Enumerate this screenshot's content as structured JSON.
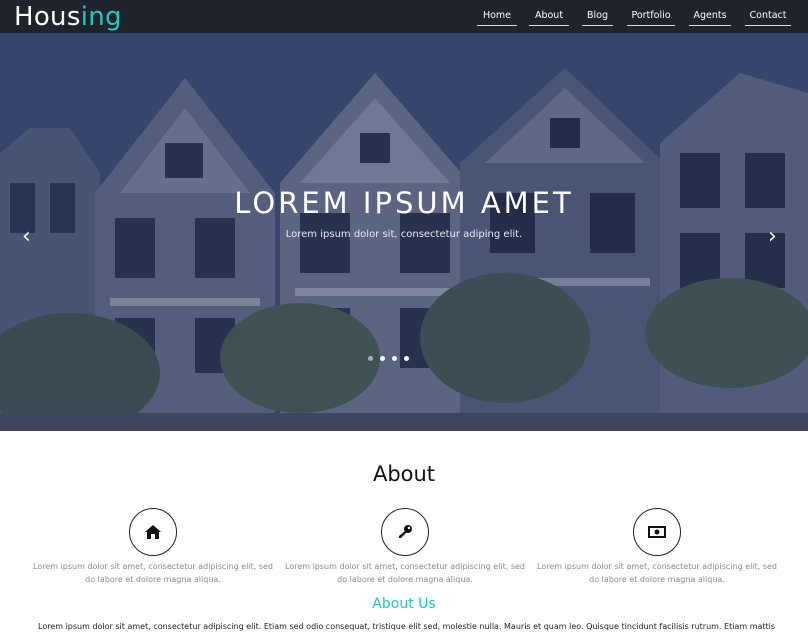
{
  "brand": {
    "part1": "Hous",
    "part2": "ing",
    "accent_color": "#23c6c0"
  },
  "nav": {
    "items": [
      {
        "label": "Home"
      },
      {
        "label": "About"
      },
      {
        "label": "Blog"
      },
      {
        "label": "Portfolio"
      },
      {
        "label": "Agents"
      },
      {
        "label": "Contact"
      }
    ],
    "background": "#1e232c"
  },
  "hero": {
    "title": "LOREM IPSUM AMET",
    "subtitle": "Lorem ipsum dolor sit, consectetur adiping elit.",
    "prev_icon": "chevron-left-icon",
    "next_icon": "chevron-right-icon",
    "prev_glyph": "‹",
    "next_glyph": "›",
    "slide_count": 4,
    "active_slide": 2
  },
  "about": {
    "heading": "About",
    "features": [
      {
        "icon": "home-icon",
        "text": "Lorem ipsum dolor sit amet, consectetur adipiscing elit, sed do labore et dolore magna aliqua."
      },
      {
        "icon": "key-icon",
        "text": "Lorem ipsum dolor sit amet, consectetur adipiscing elit, sed do labore et dolore magna aliqua."
      },
      {
        "icon": "money-icon",
        "text": "Lorem ipsum dolor sit amet, consectetur adipiscing elit, sed do labore et dolore magna aliqua."
      }
    ]
  },
  "about_us": {
    "heading": "About Us",
    "text": "Lorem ipsum dolor sit amet, consectetur adipiscing elit. Etiam sed odio consequat, tristique elit sed, molestie nulla. Mauris et quam leo. Quisque tincidunt facilisis rutrum. Etiam mattis arcu vitae velit sagittis"
  }
}
